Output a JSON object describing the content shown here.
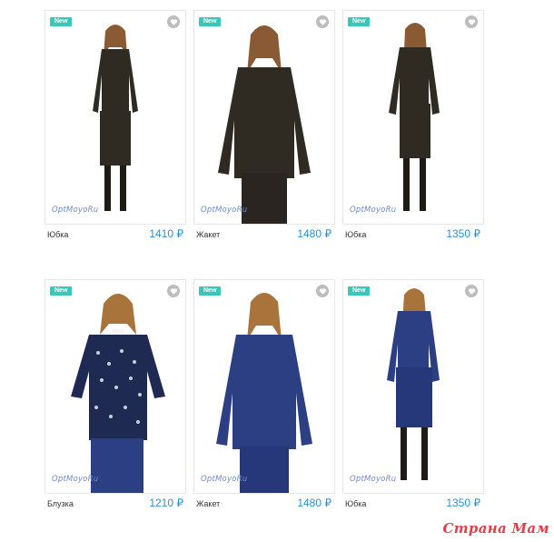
{
  "products": [
    {
      "badge": "New",
      "logo": "OptMoyoRu",
      "name": "Юбка",
      "price": "1410 ₽"
    },
    {
      "badge": "New",
      "logo": "OptMoyoRu",
      "name": "Жакет",
      "price": "1480 ₽"
    },
    {
      "badge": "New",
      "logo": "OptMoyoRu",
      "name": "Юбка",
      "price": "1350 ₽"
    },
    {
      "badge": "New",
      "logo": "OptMoyoRu",
      "name": "Блузка",
      "price": "1210 ₽"
    },
    {
      "badge": "New",
      "logo": "OptMoyoRu",
      "name": "Жакет",
      "price": "1480 ₽"
    },
    {
      "badge": "New",
      "logo": "OptMoyoRu",
      "name": "Юбка",
      "price": "1350 ₽"
    }
  ],
  "watermark": "Страна Мам",
  "colors": {
    "badge": "#3cc5bb",
    "price": "#2f8fd0",
    "watermark": "#e0404a",
    "suit_dark": "#2f2a22",
    "suit_blue": "#2c3f82"
  }
}
